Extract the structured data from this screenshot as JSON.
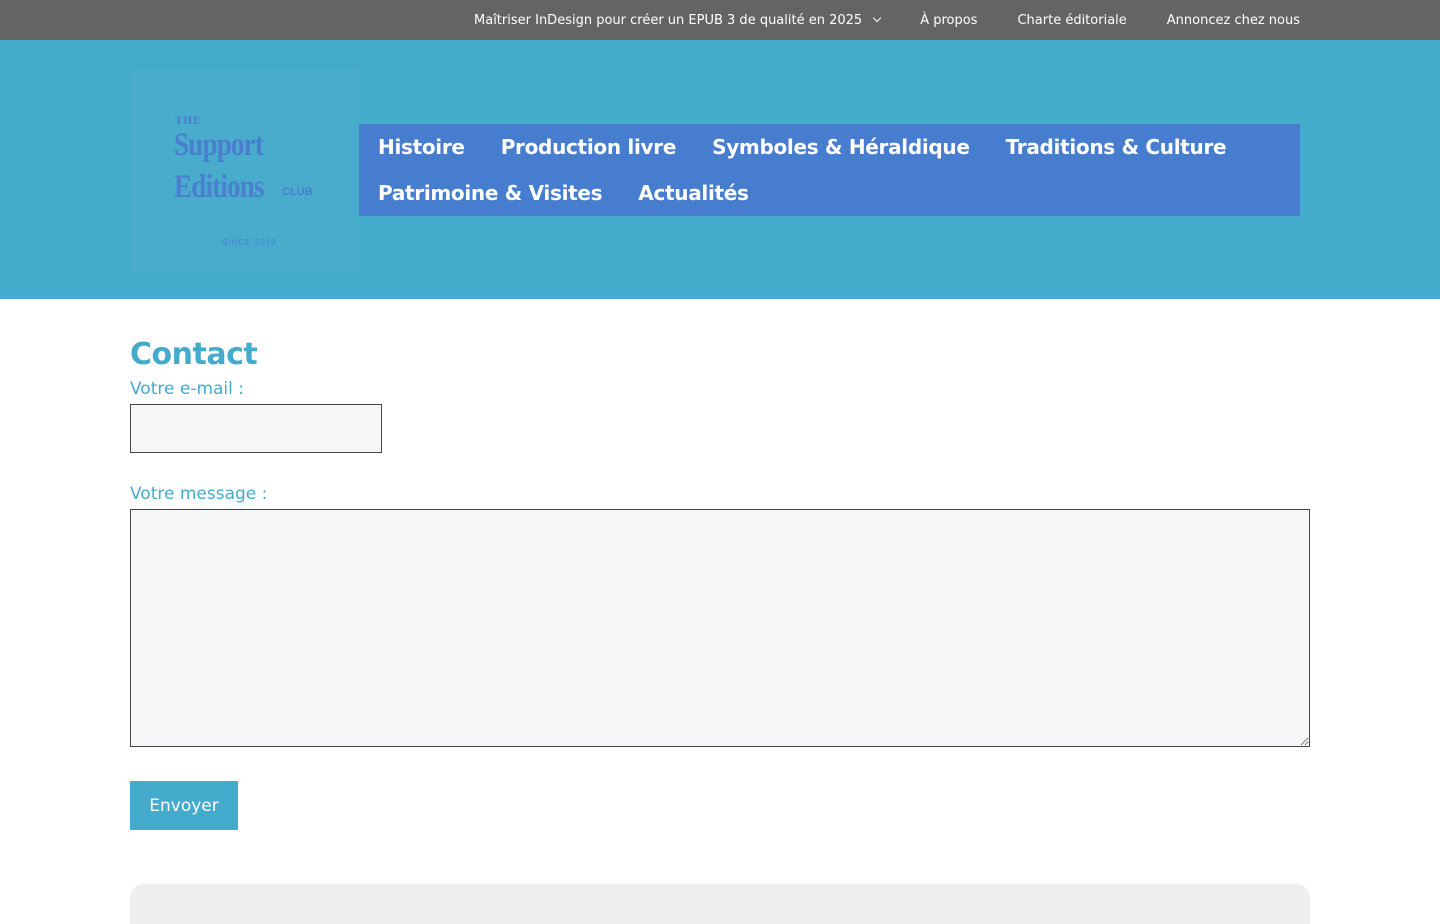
{
  "topbar": {
    "items": [
      {
        "label": "Maîtriser InDesign pour créer un EPUB 3 de qualité en 2025",
        "has_dropdown": true
      },
      {
        "label": "À propos"
      },
      {
        "label": "Charte éditoriale"
      },
      {
        "label": "Annoncez chez nous"
      }
    ]
  },
  "logo": {
    "line_the": "THE",
    "line_support": "Support",
    "line_editions": "Editions",
    "line_club": "CLUB",
    "line_since": "SINCE 2010"
  },
  "main_nav": {
    "row1": [
      {
        "label": "Histoire"
      },
      {
        "label": "Production livre"
      },
      {
        "label": "Symboles & Héraldique"
      },
      {
        "label": "Traditions & Culture"
      }
    ],
    "row2": [
      {
        "label": "Patrimoine & Visites"
      },
      {
        "label": "Actualités"
      }
    ]
  },
  "contact": {
    "title": "Contact",
    "email_label": "Votre e-mail :",
    "email_value": "",
    "message_label": "Votre message :",
    "message_value": "",
    "submit_label": "Envoyer"
  },
  "colors": {
    "topbar_bg": "#646464",
    "header_bg": "#45abcc",
    "nav_bg": "#477dcf",
    "accent": "#45abcc",
    "input_bg": "#f5f6f7"
  }
}
